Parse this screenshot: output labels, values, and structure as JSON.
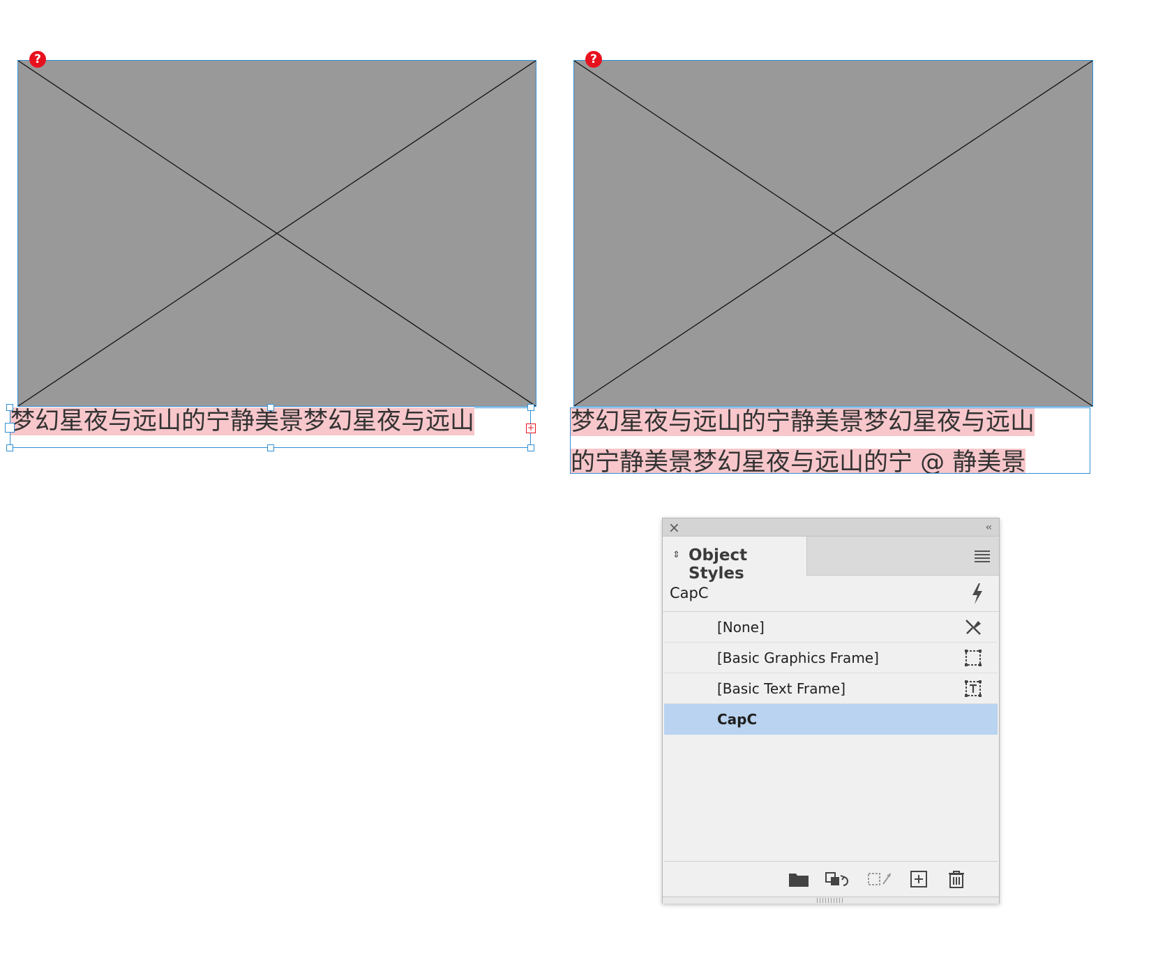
{
  "canvas": {
    "left_frame": {
      "caption_text": "梦幻星夜与远山的宁静美景梦幻星夜与远山",
      "status": "missing-link",
      "badge_symbol": "?",
      "overset_symbol": "+"
    },
    "right_frame": {
      "caption_line_1": "梦幻星夜与远山的宁静美景梦幻星夜与远山",
      "caption_line_2": "的宁静美景梦幻星夜与远山的宁 @ 静美景",
      "status": "missing-link",
      "badge_symbol": "?"
    },
    "colors": {
      "placeholder_fill": "#999999",
      "frame_selection": "#2e8fd6",
      "caption_highlight": "#f8c7cb",
      "error_red": "#e8121e"
    }
  },
  "panel": {
    "title": "Object Styles",
    "current_style": "CapC",
    "icons": {
      "close": "close-icon",
      "collapse": "collapse-chevrons-icon",
      "panel_menu": "hamburger-menu-icon",
      "quick_apply": "lightning-icon"
    },
    "styles": [
      {
        "label": "[None]",
        "icon": "none-style-icon",
        "selected": false
      },
      {
        "label": "[Basic Graphics Frame]",
        "icon": "graphics-frame-icon",
        "selected": false
      },
      {
        "label": "[Basic Text Frame]",
        "icon": "text-frame-icon",
        "selected": false
      },
      {
        "label": "CapC",
        "icon": "",
        "selected": true
      }
    ],
    "footer_buttons": [
      "new-style-group-icon",
      "clear-overrides-icon",
      "clear-attributes-icon",
      "new-style-icon",
      "delete-style-icon"
    ],
    "selection_color": "#b9d3f0"
  }
}
